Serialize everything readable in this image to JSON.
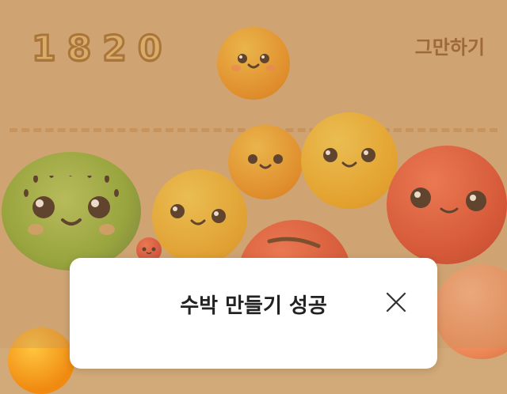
{
  "score": "1820",
  "quit_label": "그만하기",
  "dialog": {
    "title": "수박 만들기 성공"
  },
  "icons": {
    "close": "close-icon"
  },
  "colors": {
    "background": "#d6ac7b",
    "dialog": "#ffffff",
    "score_fill": "#e5b96d",
    "score_stroke": "#9b6426"
  }
}
